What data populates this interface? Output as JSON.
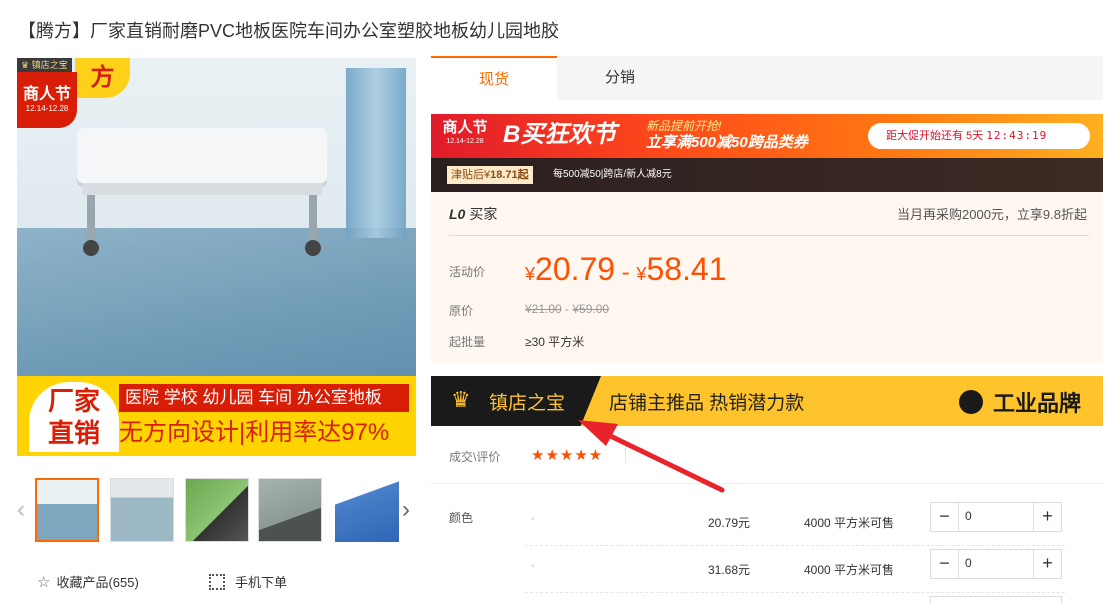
{
  "product": {
    "title": "【腾方】厂家直销耐磨PVC地板医院车间办公室塑胶地板幼儿园地胶"
  },
  "gallery": {
    "shop_badge": "镇店之宝",
    "festival_big": "商人节",
    "festival_dates": "12.14-12.28",
    "brand_corner": "方",
    "ad_left_line1": "厂家",
    "ad_left_line2": "直销",
    "ad_red_text": "医院 学校 幼儿园 车间 办公室地板",
    "ad_slogan": "无方向设计|利用率达97%",
    "prev_arrow": "‹",
    "next_arrow": "›"
  },
  "actions": {
    "favorite_label": "收藏产品(655)",
    "mobile_label": "手机下单"
  },
  "tabs": [
    {
      "label": "现货"
    },
    {
      "label": "分销"
    }
  ],
  "promo": {
    "logo_big": "商人节",
    "logo_dates": "12.14-12.28",
    "title": "B买狂欢节",
    "sub_line1": "新品提前开抢!",
    "sub_line2": "立享满500减50跨品类券",
    "countdown_label": "距大促开始还有 5天 ",
    "countdown_time": "12:43:19",
    "subsidy_prefix": "津贴后¥",
    "subsidy_price": "18.71起",
    "subsidy_desc": "每500减50|跨店/新人减8元"
  },
  "pricing": {
    "buyer_level": "L0",
    "buyer_label": "买家",
    "repurchase_offer": "当月再采购2000元，立享9.8折起",
    "activity_label": "活动价",
    "price_low": "20.79",
    "price_high": "58.41",
    "price_sep": " - ",
    "currency": "¥",
    "original_label": "原价",
    "original_low": "¥21.00",
    "original_high": "¥59.00",
    "moq_label": "起批量",
    "moq_value": "≥30 平方米"
  },
  "treasure_bar": {
    "label": "镇店之宝",
    "text": "店铺主推品  热销潜力款",
    "brand": "工业品牌"
  },
  "rating": {
    "label": "成交\\评价",
    "stars": "★★★★★"
  },
  "options": {
    "color_label": "颜色",
    "skus": [
      {
        "dot": "▫",
        "price": "20.79元",
        "stock": "4000 平方米可售",
        "qty": "0"
      },
      {
        "dot": "▫",
        "price": "31.68元",
        "stock": "4000 平方米可售",
        "qty": "0"
      }
    ],
    "minus": "−",
    "plus": "+"
  },
  "colors": {
    "accent": "#ff6a00",
    "price": "#ff5000",
    "banner_red": "#d81e06",
    "banner_yellow": "#ffd400",
    "treasure_yellow": "#ffc32b",
    "annotation_arrow": "#e8232b"
  }
}
